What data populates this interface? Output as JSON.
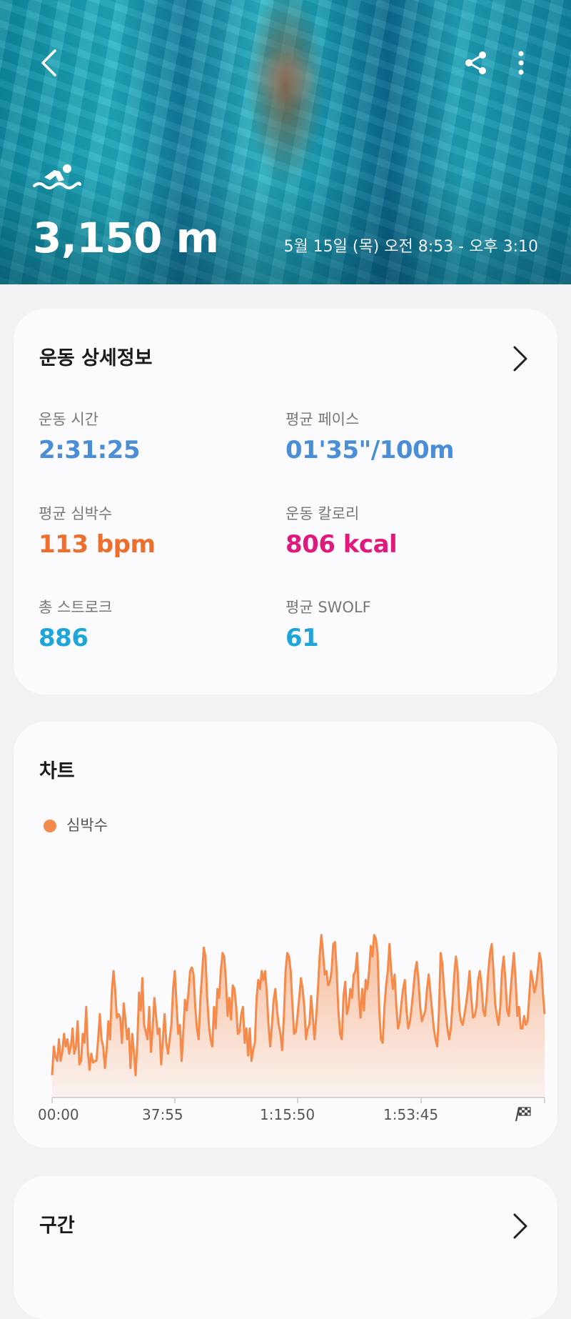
{
  "hero": {
    "distance": "3,150 m",
    "datetime": "5월 15일 (목) 오전 8:53 - 오후 3:10",
    "back_icon": "chevron-left-icon",
    "share_icon": "share-icon",
    "more_icon": "more-vertical-icon",
    "activity_icon": "swimming-icon"
  },
  "details": {
    "title": "운동 상세정보",
    "items": [
      {
        "label": "운동 시간",
        "value": "2:31:25",
        "color": "#4a8ed8"
      },
      {
        "label": "평균 페이스",
        "value": "01'35\"/100m",
        "color": "#4a8ed8"
      },
      {
        "label": "평균 심박수",
        "value": "113 bpm",
        "color": "#ee6f2d"
      },
      {
        "label": "운동 칼로리",
        "value": "806 kcal",
        "color": "#e0197d"
      },
      {
        "label": "총 스트로크",
        "value": "886",
        "color": "#1ea6d9"
      },
      {
        "label": "평균 SWOLF",
        "value": "61",
        "color": "#1ea6d9"
      }
    ]
  },
  "chart_section": {
    "title": "차트",
    "legend": "심박수",
    "accent": "#f58a4b",
    "finish_icon": "checkered-flag-icon"
  },
  "chart_data": {
    "type": "area",
    "series": [
      {
        "name": "심박수",
        "values": [
          92,
          108,
          102,
          100,
          112,
          100,
          105,
          115,
          108,
          112,
          104,
          108,
          118,
          104,
          108,
          122,
          98,
          100,
          115,
          110,
          130,
          105,
          95,
          104,
          99,
          100,
          100,
          112,
          126,
          112,
          108,
          96,
          106,
          122,
          112,
          138,
          150,
          140,
          124,
          126,
          124,
          110,
          132,
          123,
          112,
          118,
          96,
          115,
          105,
          92,
          110,
          138,
          128,
          146,
          120,
          116,
          112,
          130,
          105,
          118,
          135,
          125,
          115,
          118,
          98,
          112,
          126,
          110,
          104,
          112,
          120,
          140,
          150,
          132,
          115,
          120,
          100,
          116,
          134,
          128,
          138,
          150,
          152,
          148,
          130,
          118,
          112,
          134,
          148,
          163,
          158,
          135,
          120,
          112,
          108,
          130,
          118,
          140,
          135,
          150,
          160,
          158,
          145,
          125,
          135,
          123,
          142,
          140,
          130,
          115,
          116,
          126,
          130,
          110,
          118,
          103,
          118,
          100,
          106,
          110,
          135,
          145,
          140,
          150,
          145,
          150,
          138,
          120,
          108,
          120,
          134,
          140,
          128,
          120,
          115,
          106,
          124,
          150,
          160,
          158,
          150,
          132,
          115,
          116,
          125,
          135,
          146,
          140,
          130,
          112,
          118,
          120,
          136,
          124,
          112,
          125,
          140,
          158,
          170,
          160,
          148,
          150,
          142,
          144,
          150,
          165,
          166,
          150,
          128,
          115,
          112,
          136,
          144,
          126,
          130,
          140,
          135,
          148,
          150,
          160,
          136,
          124,
          140,
          128,
          145,
          140,
          150,
          164,
          158,
          170,
          168,
          160,
          128,
          112,
          110,
          130,
          142,
          150,
          165,
          150,
          140,
          148,
          130,
          118,
          122,
          132,
          140,
          145,
          128,
          118,
          122,
          130,
          140,
          150,
          155,
          145,
          130,
          122,
          125,
          128,
          140,
          148,
          138,
          128,
          118,
          112,
          108,
          128,
          160,
          154,
          140,
          128,
          118,
          112,
          118,
          132,
          148,
          158,
          150,
          128,
          122,
          120,
          126,
          132,
          140,
          150,
          135,
          124,
          125,
          130,
          145,
          150,
          142,
          128,
          125,
          135,
          150,
          160,
          165,
          150,
          132,
          125,
          120,
          130,
          150,
          158,
          145,
          128,
          125,
          138,
          150,
          160,
          145,
          125,
          130,
          118,
          118,
          125,
          120,
          122,
          136,
          150,
          145,
          138,
          142,
          150,
          160,
          155,
          138,
          126
        ]
      }
    ],
    "x_ticks": [
      "00:00",
      "37:55",
      "1:15:50",
      "1:53:45"
    ],
    "ylim": [
      80,
      175
    ]
  },
  "sections": {
    "title": "구간"
  }
}
